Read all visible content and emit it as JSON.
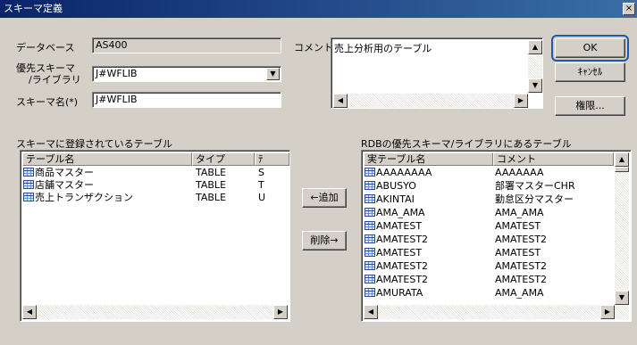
{
  "window": {
    "title": "スキーマ定義",
    "close": "×"
  },
  "form": {
    "database_label": "データベース",
    "database_value": "AS400",
    "priority_schema_label_1": "優先スキーマ",
    "priority_schema_label_2": "/ライブラリ",
    "priority_schema_value": "J#WFLIB",
    "schema_name_label": "スキーマ名(*)",
    "schema_name_value": "J#WFLIB",
    "comment_label": "コメント",
    "comment_value": "売上分析用のテーブル"
  },
  "buttons": {
    "ok": "OK",
    "cancel": "ｷｬﾝｾﾙ",
    "permission": "権限...",
    "add": "←追加",
    "remove": "削除→"
  },
  "left_list": {
    "heading": "スキーマに登録されているテーブル",
    "columns": [
      "テーブル名",
      "タイプ",
      "ﾃ"
    ],
    "rows": [
      {
        "name": "商品マスター",
        "type": "TABLE",
        "extra": "S"
      },
      {
        "name": "店舗マスター",
        "type": "TABLE",
        "extra": "T"
      },
      {
        "name": "売上トランザクション",
        "type": "TABLE",
        "extra": "U"
      }
    ]
  },
  "right_list": {
    "heading": "RDBの優先スキーマ/ライブラリにあるテーブル",
    "columns": [
      "実テーブル名",
      "コメント"
    ],
    "rows": [
      {
        "name": "AAAAAAAA",
        "comment": "AAAAAAA"
      },
      {
        "name": "ABUSYO",
        "comment": "部署マスターCHR"
      },
      {
        "name": "AKINTAI",
        "comment": "勤怠区分マスター"
      },
      {
        "name": "AMA_AMA",
        "comment": "AMA_AMA"
      },
      {
        "name": "AMATEST",
        "comment": "AMATEST"
      },
      {
        "name": "AMATEST2",
        "comment": "AMATEST2"
      },
      {
        "name": "AMATEST",
        "comment": "AMATEST"
      },
      {
        "name": "AMATEST2",
        "comment": "AMATEST2"
      },
      {
        "name": "AMATEST2",
        "comment": "AMATEST2"
      },
      {
        "name": "AMURATA",
        "comment": "AMA_AMA"
      }
    ]
  },
  "icons": {
    "dropdown": "dropdown-arrow-icon",
    "table": "table-icon",
    "scroll_up": "scroll-up-icon",
    "scroll_down": "scroll-down-icon",
    "scroll_left": "scroll-left-icon",
    "scroll_right": "scroll-right-icon"
  },
  "colors": {
    "dialog_bg": "#d4d0c8",
    "title_bar": "#0a246a",
    "default_button_outline": "#1e5aa8"
  }
}
